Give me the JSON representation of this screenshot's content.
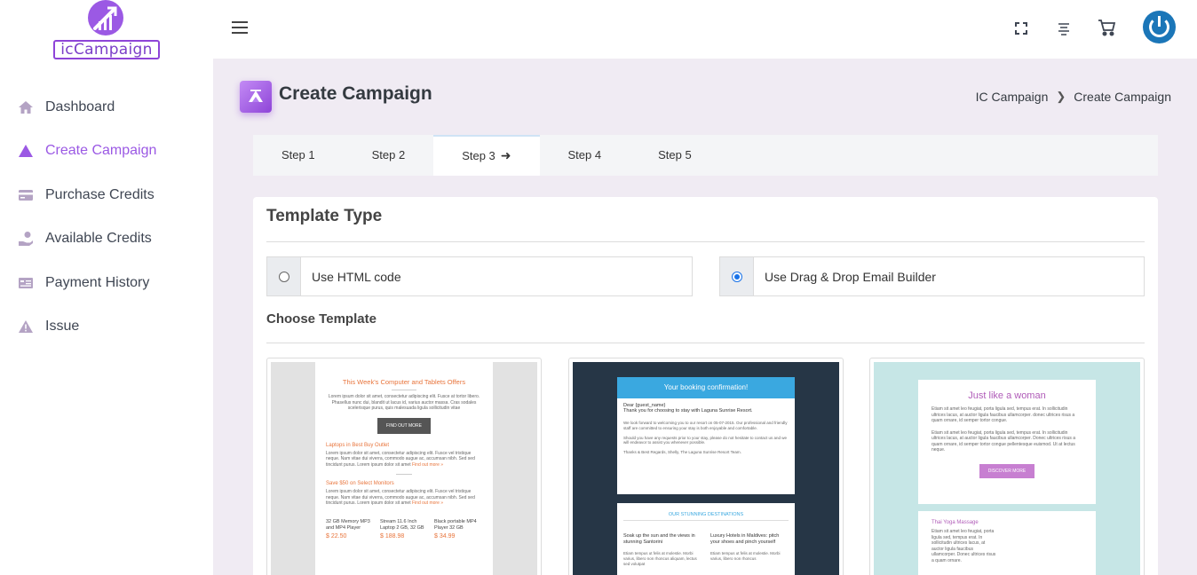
{
  "sidebar": {
    "logo_text": "icCampaign",
    "items": [
      {
        "label": "Dashboard",
        "icon": "home-icon"
      },
      {
        "label": "Create Campaign",
        "icon": "campaign-icon",
        "active": true
      },
      {
        "label": "Purchase Credits",
        "icon": "credit-card-icon"
      },
      {
        "label": "Available Credits",
        "icon": "hand-coin-icon"
      },
      {
        "label": "Payment History",
        "icon": "receipt-icon"
      },
      {
        "label": "Issue",
        "icon": "warning-icon"
      }
    ]
  },
  "topbar": {
    "icons": [
      "menu-icon",
      "fullscreen-icon",
      "align-icon",
      "cart-icon",
      "power-icon"
    ]
  },
  "page": {
    "title": "Create Campaign",
    "breadcrumb": [
      "IC Campaign",
      "Create Campaign"
    ]
  },
  "steps": [
    "Step 1",
    "Step 2",
    "Step 3",
    "Step 4",
    "Step 5"
  ],
  "active_step": "Step 3",
  "template_type": {
    "title": "Template Type",
    "options": [
      {
        "label": "Use HTML code",
        "selected": false
      },
      {
        "label": "Use Drag & Drop Email Builder",
        "selected": true
      }
    ]
  },
  "choose_template": {
    "title": "Choose Template",
    "t1": {
      "heading": "This Week's Computer and Tablets Offers",
      "body": "Lorem ipsum dolor sit amet, consectetur adipiscing elit. Fusce at tortor libero. Phasellus nunc dui, blandit ut lacus id, varius auctor massa. Cras sodales scelerisque purus, quis malesuada ligula sollicitudin vitae",
      "button": "FIND OUT MORE",
      "s1_title": "Laptops in Best Buy Outlet",
      "s1_body": "Lorem ipsum dolor sit amet, consectetur adipiscing elit. Fusce vel tristique neque. Nam vitae dui viverra, commodo augue ac, accumsan nibh. Sed sed tincidunt purus. Lorem ipsum dolor sit amet",
      "s2_title": "Save $50 on Select Monitors",
      "s2_body": "Lorem ipsum dolor sit amet, consectetur adipiscing elit. Fusce vel tristique neque. Nam vitae dui viverra, commodo augue ac, accumsan nibh. Sed sed tincidunt purus. Lorem ipsum dolor sit amet",
      "link": "Find out more »",
      "products": [
        {
          "name": "32 GB Memory MP3 and MP4 Player",
          "price": "$ 22.50"
        },
        {
          "name": "Stream 11.6 Inch Laptop 2 GB, 32 GB",
          "price": "$ 188.98"
        },
        {
          "name": "Black portable MP4 Player 32 GB",
          "price": "$ 34.99"
        }
      ]
    },
    "t2": {
      "header": "Your booking confirmation!",
      "greeting": "Dear {guest_name}",
      "thanks": "Thank you for choosing to stay with Laguna Sunrise Resort.",
      "p1": "We look forward to welcoming you to our resort on 05-07-2015. Our professional and friendly staff are committed to ensuring your stay is both enjoyable and comfortable.",
      "p2": "Should you have any requests prior to your stay, please do not hesitate to contact us and we will endeavor to assist you whenever possible.",
      "sign": "Thanks & Best Regards, Shelly, The Laguna Sunrise Resort Team.",
      "section": "OUR STUNNING DESTINATIONS",
      "col1_title": "Soak up the sun and the views in stunning Santorini",
      "col1_body": "Etiam tempus ut felis at molestie. Morbi varius, libero non rhoncus aliquam, lectus sed volutpat",
      "col2_title": "Luxury Hotels in Maldives: pitch your shoes and pinch yourself",
      "col2_body": "Etiam tempus ut felis at molestie. Morbi varius, libero non rhoncus"
    },
    "t3": {
      "heading": "Just like a woman",
      "p1": "Etiam sit amet leo feugiat, porta ligula sed, tempus erat. In sollicitudin ultrices lacus, at auctor ligula faucibus ullamcorper. donec ultrices risus a quam ornare, id semper tortor congue.",
      "p2": "Etiam sit amet leo feugiat, porta ligula sed, tempus erat. In sollicitudin ultrices lacus, at auctor ligula faucibus ullamcorper. Donec ultrices risus a quam ornare, id semper tortor congue pellentesque euismod. Ut at lectus neque.",
      "button": "DISCOVER MORE",
      "s_title": "Thai Yoga Massage",
      "s_body": "Etiam sit amet leo feugiat, porta ligula sed, tempus erat. In sollicitudin ultrices lacus, at auctor ligula faucibus ullamcorper. Donec ultrices risus a quam ornare."
    }
  },
  "colors": {
    "accent": "#9b59e4",
    "main_bg": "#f0ebf3",
    "radio_selected": "#1a73e8"
  }
}
